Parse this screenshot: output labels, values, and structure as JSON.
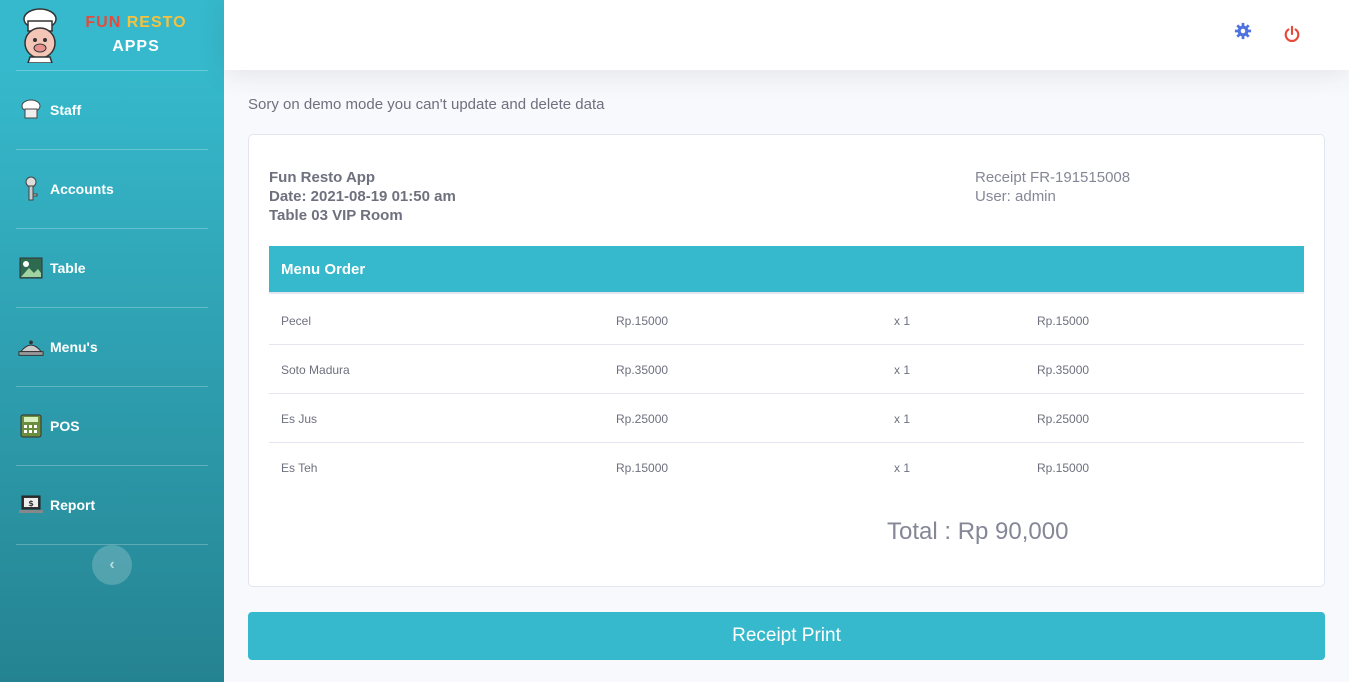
{
  "brand": {
    "fun": "FUN",
    "resto": "RESTO",
    "apps": "APPS"
  },
  "sidebar": {
    "items": [
      {
        "label": "Staff",
        "icon": "chef-hat-icon"
      },
      {
        "label": "Accounts",
        "icon": "key-icon"
      },
      {
        "label": "Table",
        "icon": "picture-icon"
      },
      {
        "label": "Menu's",
        "icon": "food-tray-icon"
      },
      {
        "label": "POS",
        "icon": "calculator-icon"
      },
      {
        "label": "Report",
        "icon": "laptop-report-icon"
      }
    ],
    "toggle": "‹"
  },
  "topbar": {
    "settings_icon": "gear-icon",
    "logout_icon": "power-icon"
  },
  "notice": "Sory on demo mode you can't update and delete data",
  "receipt": {
    "app_name": "Fun Resto App",
    "date": "Date: 2021-08-19 01:50 am",
    "table": "Table 03 VIP Room",
    "number": "Receipt FR-191515008",
    "user": "User: admin",
    "header": "Menu Order",
    "items": [
      {
        "name": "Pecel",
        "price": "Rp.15000",
        "qty": "x 1",
        "subtotal": "Rp.15000"
      },
      {
        "name": "Soto Madura",
        "price": "Rp.35000",
        "qty": "x 1",
        "subtotal": "Rp.35000"
      },
      {
        "name": "Es Jus",
        "price": "Rp.25000",
        "qty": "x 1",
        "subtotal": "Rp.25000"
      },
      {
        "name": "Es Teh",
        "price": "Rp.15000",
        "qty": "x 1",
        "subtotal": "Rp.15000"
      }
    ],
    "total": "Total : Rp 90,000"
  },
  "print_button": "Receipt Print",
  "colors": {
    "primary": "#36b9cc",
    "danger": "#e74a3b",
    "warning": "#f6c23e",
    "settings": "#4e73df"
  }
}
